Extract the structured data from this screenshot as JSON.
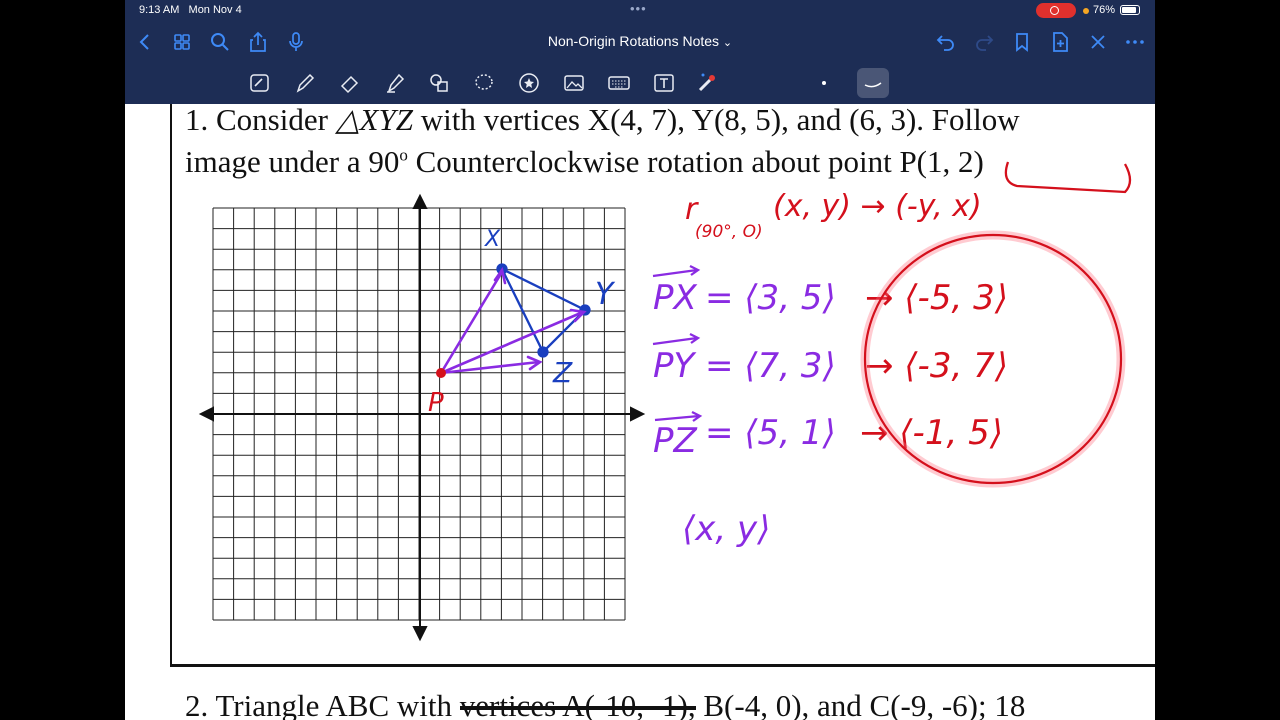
{
  "status": {
    "time": "9:13 AM",
    "date": "Mon Nov 4",
    "battery": "76%"
  },
  "nav": {
    "title": "Non-Origin Rotations Notes",
    "title_caret": "⌄"
  },
  "icons": {
    "nav": [
      "back-icon",
      "grid-icon",
      "search-icon",
      "share-icon",
      "microphone-icon"
    ],
    "nav_right": [
      "undo-icon",
      "redo-icon",
      "bookmark-icon",
      "add-page-icon",
      "close-icon",
      "more-icon"
    ],
    "tools": [
      "lasso-pen-icon",
      "pen-icon",
      "eraser-icon",
      "highlighter-icon",
      "shapes-icon",
      "lasso-icon",
      "sticker-icon",
      "image-icon",
      "keyboard-icon",
      "text-icon",
      "laser-pointer-icon"
    ]
  },
  "colors": {
    "bar": "#1d2d55",
    "accent": "#3e8af7",
    "ink_blue": "#1a3fbf",
    "ink_purple": "#8a2be2",
    "ink_red": "#d4101c"
  },
  "worksheet": {
    "q1_l1_a": "1. Consider ",
    "q1_l1_tri": "△XYZ",
    "q1_l1_b": " with vertices X(4, 7), Y(8, 5), and (6, 3). Follow",
    "q1_l2_a": "image under a 90",
    "q1_l2_sup": "o",
    "q1_l2_b": " Counterclockwise rotation about point P(1, 2)",
    "q2_a": "2. Triangle ABC with ",
    "q2_struck": "vertices A(-10, -1),",
    "q2_b": " B(-4, 0), and C(-9, -6); 18"
  },
  "annotations": {
    "rule": "r",
    "rule_sub": "(90°, O)",
    "rule_map": "(x, y) → (-y, x)",
    "label_x": "X",
    "label_y": "Y",
    "label_z": "Z",
    "label_p": "P",
    "px_label": "PX",
    "px_vec": "= ⟨3, 5⟩",
    "px_rot": "→ ⟨-5, 3⟩",
    "py_label": "PY",
    "py_vec": "= ⟨7, 3⟩",
    "py_rot": "→ ⟨-3, 7⟩",
    "pz_label": "PZ",
    "pz_vec": "= ⟨5, 1⟩",
    "pz_rot": "→ ⟨-1, 5⟩",
    "generic_vec": "⟨x, y⟩"
  }
}
